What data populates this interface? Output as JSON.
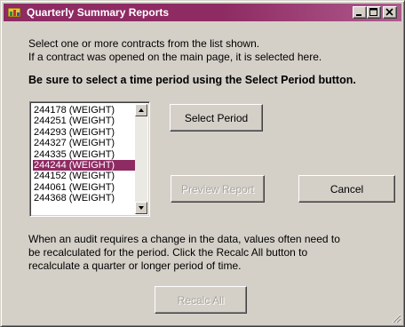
{
  "window": {
    "title": "Quarterly Summary Reports",
    "accent_color": "#8e2b63",
    "icon": "app-icon",
    "controls": [
      "minimize-icon",
      "maximize-icon",
      "close-icon"
    ]
  },
  "instructions": {
    "line1": "Select one or more contracts from the list shown.",
    "line2": "If a contract was opened on the main page, it is selected here.",
    "warning": "Be sure to select a time period using the Select Period button."
  },
  "contracts": {
    "items": [
      "244178  (WEIGHT)",
      "244251  (WEIGHT)",
      "244293  (WEIGHT)",
      "244327  (WEIGHT)",
      "244335  (WEIGHT)",
      "244244  (WEIGHT)",
      "244152  (WEIGHT)",
      "244061  (WEIGHT)",
      "244368  (WEIGHT)"
    ],
    "selected": "244244  (WEIGHT)"
  },
  "buttons": {
    "select_period": "Select Period",
    "preview_report": "Preview Report",
    "cancel": "Cancel",
    "recalc_all": "Recalc All"
  },
  "recalc_note": {
    "line1": "When an audit requires a change in the data, values often need to",
    "line2": "be recalculated for the period.  Click the Recalc All button to",
    "line3": "recalculate a quarter or longer period of time."
  }
}
